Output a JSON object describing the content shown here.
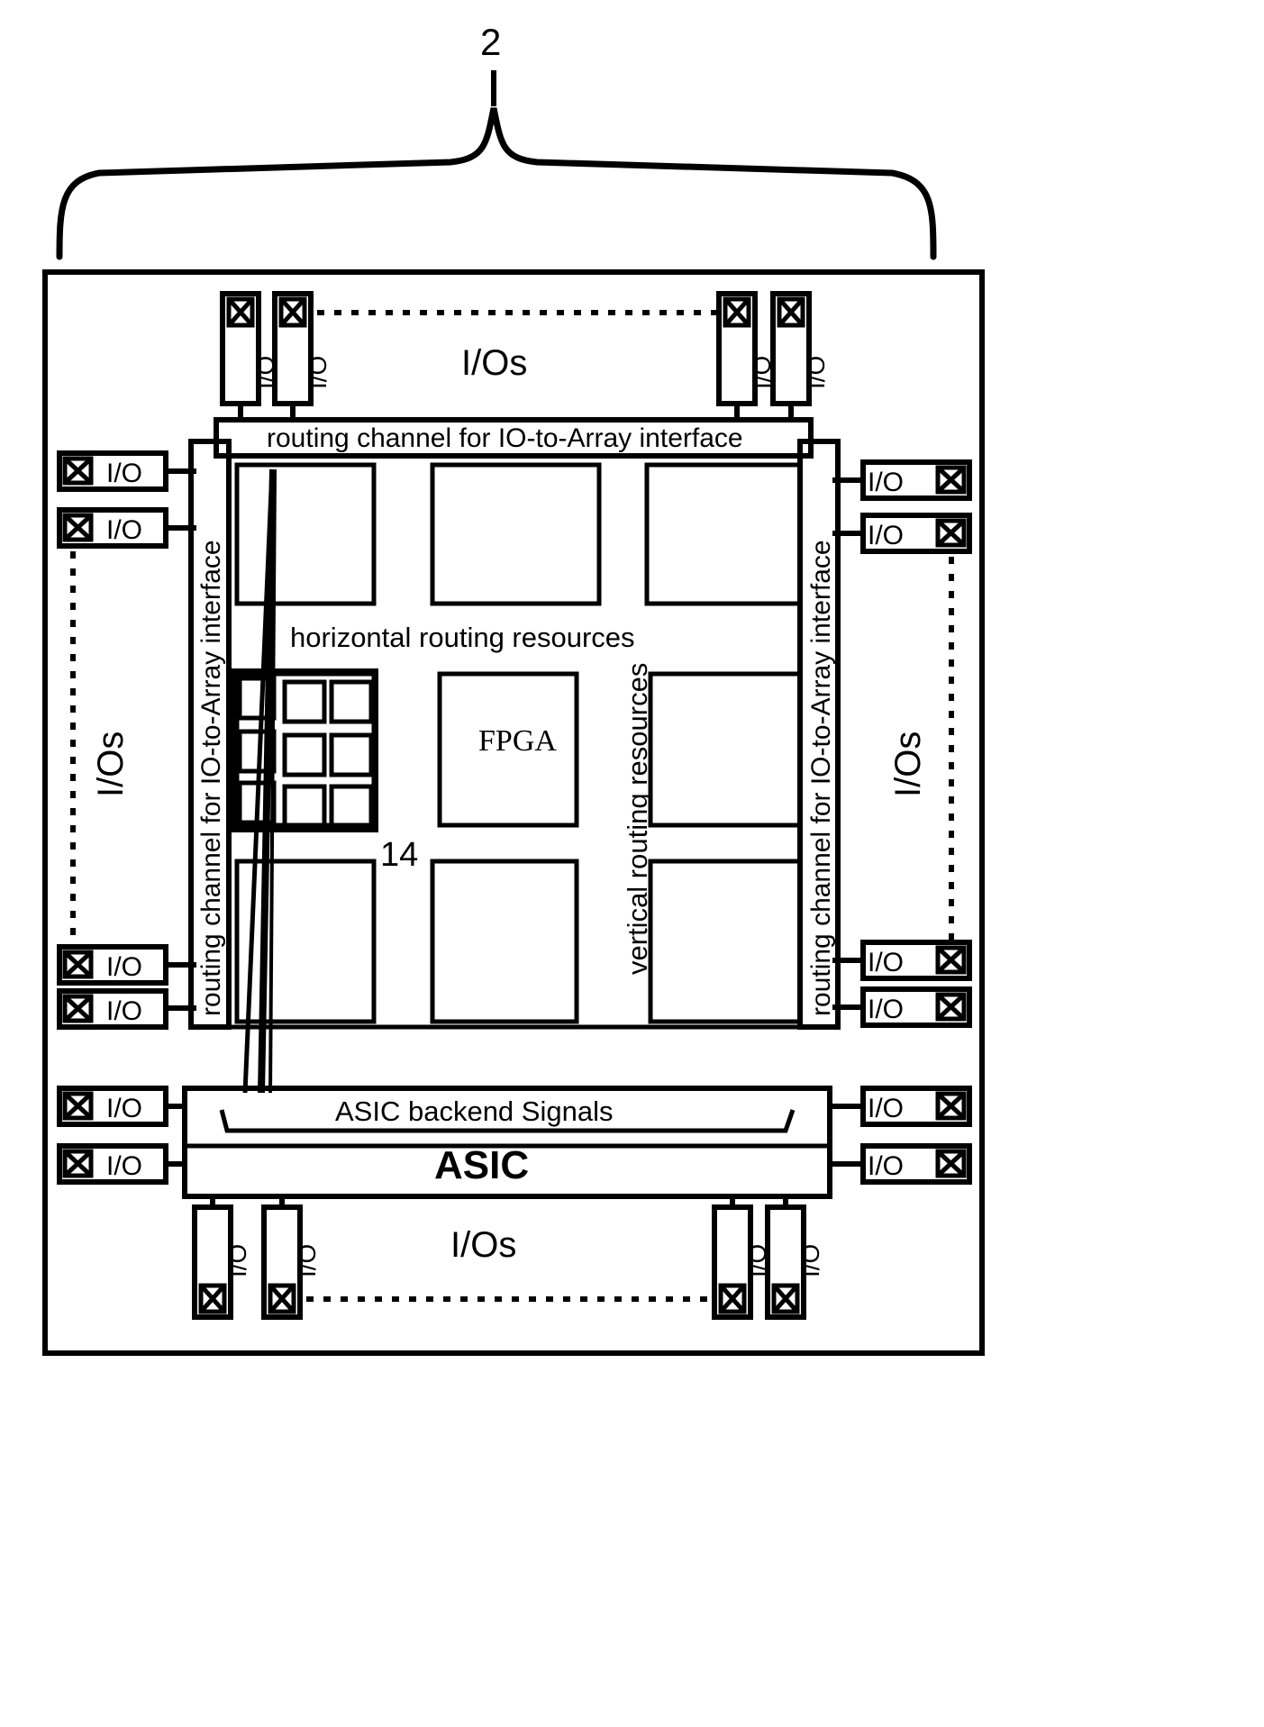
{
  "figure": {
    "brace_label": "2",
    "inner_label": "14"
  },
  "io_pads": {
    "pad_text": "I/O",
    "bond_pad_icon": "x-bond-pad-icon"
  },
  "edges": {
    "top": {
      "group_label": "I/Os",
      "routing_label": "routing channel for IO-to-Array interface",
      "pad_count": 4
    },
    "left": {
      "group_label": "I/Os",
      "routing_label": "routing channel for IO-to-Array interface",
      "pad_count": 4
    },
    "right": {
      "group_label": "I/Os",
      "routing_label": "routing channel for IO-to-Array interface",
      "pad_count": 4
    },
    "bottom": {
      "group_label": "I/Os",
      "pad_count": 4
    }
  },
  "core": {
    "fpga_label": "FPGA",
    "horizontal_routing_label": "horizontal routing resources",
    "vertical_routing_label": "vertical routing resources"
  },
  "asic": {
    "backend_label": "ASIC backend Signals",
    "title": "ASIC",
    "left_pads": [
      "I/O",
      "I/O"
    ],
    "right_pads": [
      "I/O",
      "I/O"
    ]
  },
  "colors": {
    "ink": "#000000",
    "paper": "#ffffff"
  }
}
